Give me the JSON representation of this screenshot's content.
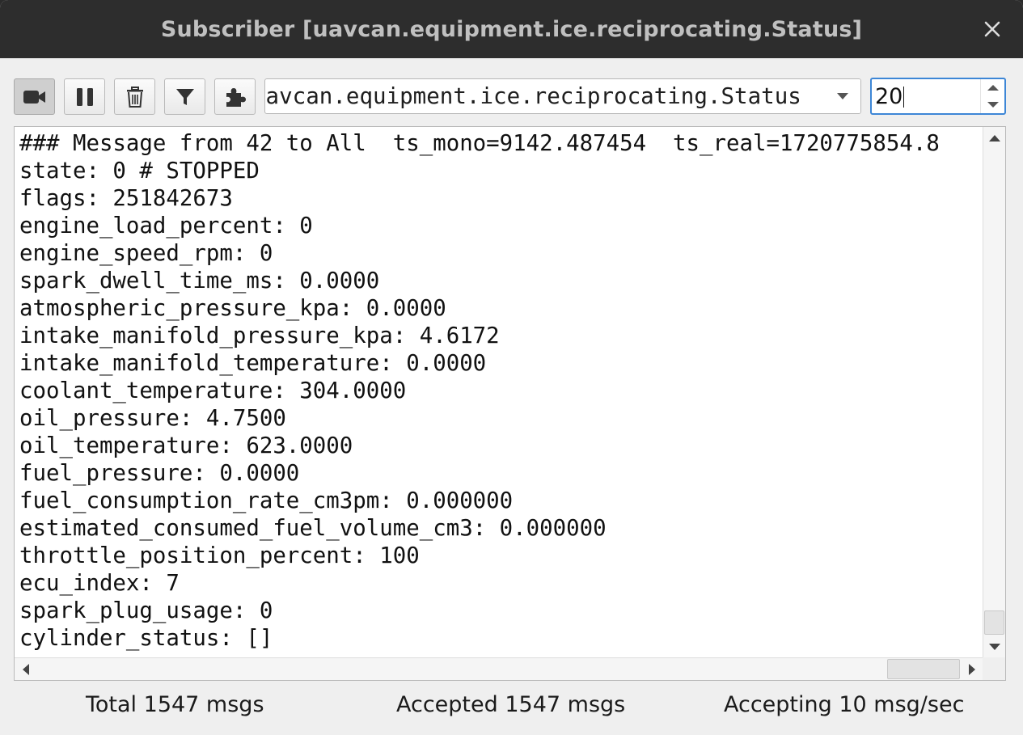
{
  "window": {
    "title": "Subscriber [uavcan.equipment.ice.reciprocating.Status]",
    "close_icon": "close-icon"
  },
  "toolbar": {
    "buttons": [
      {
        "name": "record-button",
        "icon": "video-camera-icon",
        "pressed": true
      },
      {
        "name": "pause-button",
        "icon": "pause-icon",
        "pressed": false
      },
      {
        "name": "clear-button",
        "icon": "trash-icon",
        "pressed": false
      },
      {
        "name": "filter-button",
        "icon": "filter-funnel-icon",
        "pressed": false
      },
      {
        "name": "plugin-button",
        "icon": "puzzle-piece-icon",
        "pressed": false
      }
    ],
    "data_type": "uavcan.equipment.ice.reciprocating.Status",
    "max_messages": "20"
  },
  "log": {
    "lines": [
      "### Message from 42 to All  ts_mono=9142.487454  ts_real=1720775854.8",
      "state: 0 # STOPPED",
      "flags: 251842673",
      "engine_load_percent: 0",
      "engine_speed_rpm: 0",
      "spark_dwell_time_ms: 0.0000",
      "atmospheric_pressure_kpa: 0.0000",
      "intake_manifold_pressure_kpa: 4.6172",
      "intake_manifold_temperature: 0.0000",
      "coolant_temperature: 304.0000",
      "oil_pressure: 4.7500",
      "oil_temperature: 623.0000",
      "fuel_pressure: 0.0000",
      "fuel_consumption_rate_cm3pm: 0.000000",
      "estimated_consumed_fuel_volume_cm3: 0.000000",
      "throttle_position_percent: 100",
      "ecu_index: 7",
      "spark_plug_usage: 0",
      "cylinder_status: []"
    ]
  },
  "status": {
    "total": "Total 1547 msgs",
    "accepted": "Accepted 1547 msgs",
    "rate": "Accepting 10 msg/sec"
  },
  "colors": {
    "titlebar": "#2d2d2d",
    "focus_border": "#3d86d6",
    "window_bg": "#efefef"
  }
}
